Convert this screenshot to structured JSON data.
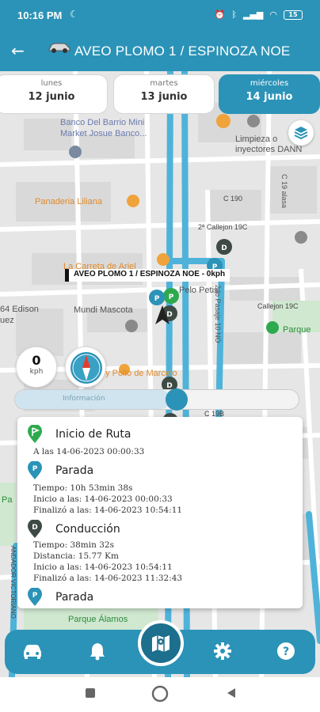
{
  "status_bar": {
    "time": "10:16 PM",
    "battery": "15"
  },
  "app_bar": {
    "title": "AVEO PLOMO 1 / ESPINOZA NOE"
  },
  "days": [
    {
      "name": "lunes",
      "date": "12 junio",
      "active": false
    },
    {
      "name": "martes",
      "date": "13 junio",
      "active": false
    },
    {
      "name": "miércoles",
      "date": "14 junio",
      "active": true
    }
  ],
  "map": {
    "labels": [
      "Banco Del Barrio Mini",
      "Market Josue Banco...",
      "Limpieza o",
      "inyectores DANN",
      "Panaderia Liliana",
      "C 190",
      "2ª Callejon 19C",
      "La Carreta de Ariel",
      "Pelo Petis",
      "Callejon 19C",
      "64 Edison",
      "uez",
      "Mundi Mascota",
      "Parque",
      "ey Pollo de Marcelo",
      "C 19B",
      "Parque Álamos",
      "2do Pasaje 10 NO",
      "1er Pasaje 10 NO",
      "C 19 alasa",
      "Pa",
      "ANDADOR VICTORIANO"
    ],
    "vehicle_label": "AVEO PLOMO 1 / ESPINOZA NOE - 0kph"
  },
  "speed": {
    "value": "0",
    "unit": "kph"
  },
  "timeline": {
    "label": "Información"
  },
  "events": [
    {
      "type": "start",
      "title": "Inicio de Ruta",
      "lines": [
        "A las 14-06-2023 00:00:33"
      ]
    },
    {
      "type": "stop",
      "title": "Parada",
      "lines": [
        "Tiempo: 10h 53min 38s",
        "Inicio a las: 14-06-2023 00:00:33",
        "Finalizó a las: 14-06-2023 10:54:11"
      ]
    },
    {
      "type": "drive",
      "title": "Conducción",
      "lines": [
        "Tiempo: 38min 32s",
        "Distancia: 15.77 Km",
        "Inicio a las: 14-06-2023 10:54:11",
        "Finalizó a las: 14-06-2023 11:32:43"
      ]
    },
    {
      "type": "stop",
      "title": "Parada",
      "lines": []
    }
  ],
  "colors": {
    "primary": "#2b93b7",
    "route": "#4fb3d9",
    "start_pin": "#2eaa4e",
    "drive_pin": "#3e4a44"
  },
  "icons": [
    "back-arrow-icon",
    "car-icon",
    "layers-icon",
    "compass-icon",
    "map-icon",
    "bell-icon",
    "gear-icon",
    "help-icon"
  ]
}
